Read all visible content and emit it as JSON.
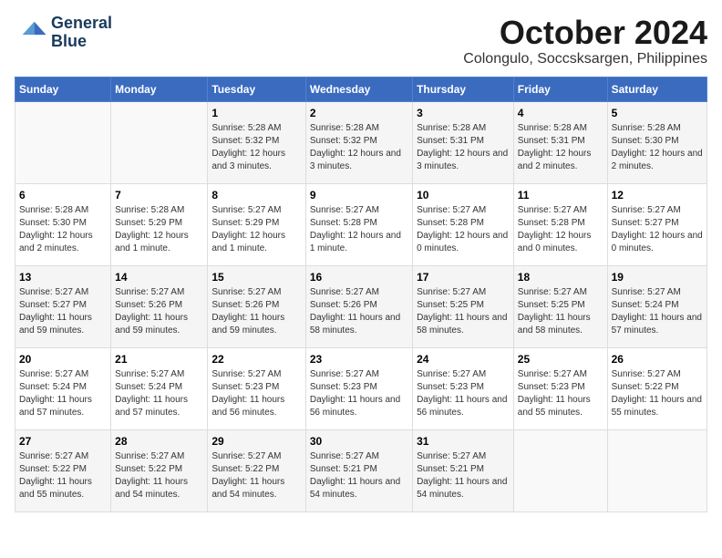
{
  "logo": {
    "line1": "General",
    "line2": "Blue"
  },
  "title": "October 2024",
  "location": "Colongulo, Soccsksargen, Philippines",
  "header": {
    "days": [
      "Sunday",
      "Monday",
      "Tuesday",
      "Wednesday",
      "Thursday",
      "Friday",
      "Saturday"
    ]
  },
  "weeks": [
    [
      {
        "day": "",
        "info": ""
      },
      {
        "day": "",
        "info": ""
      },
      {
        "day": "1",
        "info": "Sunrise: 5:28 AM\nSunset: 5:32 PM\nDaylight: 12 hours and 3 minutes."
      },
      {
        "day": "2",
        "info": "Sunrise: 5:28 AM\nSunset: 5:32 PM\nDaylight: 12 hours and 3 minutes."
      },
      {
        "day": "3",
        "info": "Sunrise: 5:28 AM\nSunset: 5:31 PM\nDaylight: 12 hours and 3 minutes."
      },
      {
        "day": "4",
        "info": "Sunrise: 5:28 AM\nSunset: 5:31 PM\nDaylight: 12 hours and 2 minutes."
      },
      {
        "day": "5",
        "info": "Sunrise: 5:28 AM\nSunset: 5:30 PM\nDaylight: 12 hours and 2 minutes."
      }
    ],
    [
      {
        "day": "6",
        "info": "Sunrise: 5:28 AM\nSunset: 5:30 PM\nDaylight: 12 hours and 2 minutes."
      },
      {
        "day": "7",
        "info": "Sunrise: 5:28 AM\nSunset: 5:29 PM\nDaylight: 12 hours and 1 minute."
      },
      {
        "day": "8",
        "info": "Sunrise: 5:27 AM\nSunset: 5:29 PM\nDaylight: 12 hours and 1 minute."
      },
      {
        "day": "9",
        "info": "Sunrise: 5:27 AM\nSunset: 5:28 PM\nDaylight: 12 hours and 1 minute."
      },
      {
        "day": "10",
        "info": "Sunrise: 5:27 AM\nSunset: 5:28 PM\nDaylight: 12 hours and 0 minutes."
      },
      {
        "day": "11",
        "info": "Sunrise: 5:27 AM\nSunset: 5:28 PM\nDaylight: 12 hours and 0 minutes."
      },
      {
        "day": "12",
        "info": "Sunrise: 5:27 AM\nSunset: 5:27 PM\nDaylight: 12 hours and 0 minutes."
      }
    ],
    [
      {
        "day": "13",
        "info": "Sunrise: 5:27 AM\nSunset: 5:27 PM\nDaylight: 11 hours and 59 minutes."
      },
      {
        "day": "14",
        "info": "Sunrise: 5:27 AM\nSunset: 5:26 PM\nDaylight: 11 hours and 59 minutes."
      },
      {
        "day": "15",
        "info": "Sunrise: 5:27 AM\nSunset: 5:26 PM\nDaylight: 11 hours and 59 minutes."
      },
      {
        "day": "16",
        "info": "Sunrise: 5:27 AM\nSunset: 5:26 PM\nDaylight: 11 hours and 58 minutes."
      },
      {
        "day": "17",
        "info": "Sunrise: 5:27 AM\nSunset: 5:25 PM\nDaylight: 11 hours and 58 minutes."
      },
      {
        "day": "18",
        "info": "Sunrise: 5:27 AM\nSunset: 5:25 PM\nDaylight: 11 hours and 58 minutes."
      },
      {
        "day": "19",
        "info": "Sunrise: 5:27 AM\nSunset: 5:24 PM\nDaylight: 11 hours and 57 minutes."
      }
    ],
    [
      {
        "day": "20",
        "info": "Sunrise: 5:27 AM\nSunset: 5:24 PM\nDaylight: 11 hours and 57 minutes."
      },
      {
        "day": "21",
        "info": "Sunrise: 5:27 AM\nSunset: 5:24 PM\nDaylight: 11 hours and 57 minutes."
      },
      {
        "day": "22",
        "info": "Sunrise: 5:27 AM\nSunset: 5:23 PM\nDaylight: 11 hours and 56 minutes."
      },
      {
        "day": "23",
        "info": "Sunrise: 5:27 AM\nSunset: 5:23 PM\nDaylight: 11 hours and 56 minutes."
      },
      {
        "day": "24",
        "info": "Sunrise: 5:27 AM\nSunset: 5:23 PM\nDaylight: 11 hours and 56 minutes."
      },
      {
        "day": "25",
        "info": "Sunrise: 5:27 AM\nSunset: 5:23 PM\nDaylight: 11 hours and 55 minutes."
      },
      {
        "day": "26",
        "info": "Sunrise: 5:27 AM\nSunset: 5:22 PM\nDaylight: 11 hours and 55 minutes."
      }
    ],
    [
      {
        "day": "27",
        "info": "Sunrise: 5:27 AM\nSunset: 5:22 PM\nDaylight: 11 hours and 55 minutes."
      },
      {
        "day": "28",
        "info": "Sunrise: 5:27 AM\nSunset: 5:22 PM\nDaylight: 11 hours and 54 minutes."
      },
      {
        "day": "29",
        "info": "Sunrise: 5:27 AM\nSunset: 5:22 PM\nDaylight: 11 hours and 54 minutes."
      },
      {
        "day": "30",
        "info": "Sunrise: 5:27 AM\nSunset: 5:21 PM\nDaylight: 11 hours and 54 minutes."
      },
      {
        "day": "31",
        "info": "Sunrise: 5:27 AM\nSunset: 5:21 PM\nDaylight: 11 hours and 54 minutes."
      },
      {
        "day": "",
        "info": ""
      },
      {
        "day": "",
        "info": ""
      }
    ]
  ]
}
